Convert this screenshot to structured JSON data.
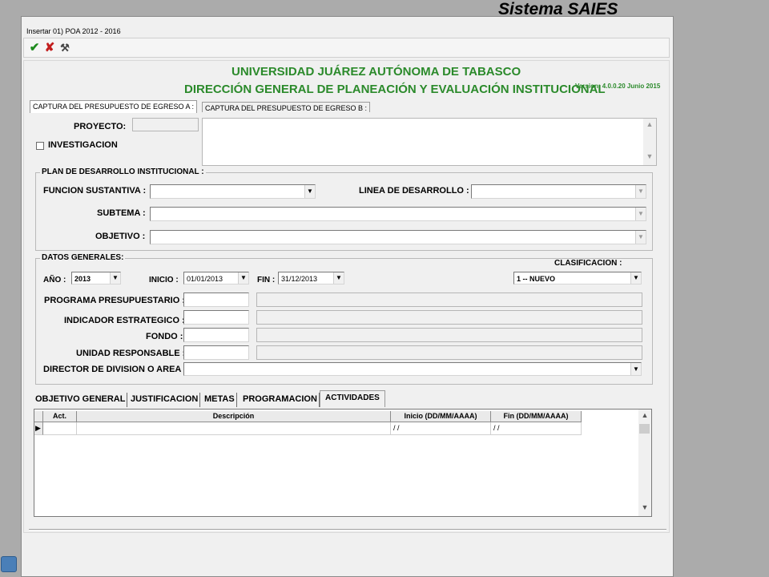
{
  "window": {
    "title": "Insertar 01) POA 2012 - 2016",
    "app_banner": "Sistema SAIES"
  },
  "toolbar": {
    "icons": [
      "check-icon",
      "cancel-x-icon",
      "tool-icon"
    ],
    "check_glyph": "✔",
    "cancel_glyph": "✘",
    "tool_glyph": "⚒"
  },
  "header": {
    "university": "UNIVERSIDAD JUÁREZ AUTÓNOMA DE TABASCO",
    "direction": "DIRECCIÓN GENERAL DE PLANEACIÓN Y EVALUACIÓN INSTITUCIONAL",
    "version": "Version:  4.0.0.20 Junio 2015"
  },
  "top_tabs": [
    {
      "label": "CAPTURA DEL PRESUPUESTO DE EGRESO  A :"
    },
    {
      "label": "CAPTURA DEL PRESUPUESTO DE EGRESO  B :"
    }
  ],
  "project": {
    "label": "PROYECTO:",
    "value": "",
    "investigacion_label": "INVESTIGACION",
    "investigacion_checked": false,
    "description": ""
  },
  "plan": {
    "title": "PLAN DE DESARROLLO INSTITUCIONAL :",
    "funcion_label": "FUNCION SUSTANTIVA :",
    "funcion_value": "",
    "linea_label": "LINEA DE DESARROLLO :",
    "linea_value": "",
    "subtema_label": "SUBTEMA :",
    "subtema_value": "",
    "objetivo_label": "OBJETIVO :",
    "objetivo_value": ""
  },
  "general": {
    "title": "DATOS GENERALES:",
    "anio_label": "AÑO :",
    "anio_value": "2013",
    "inicio_label": "INICIO :",
    "inicio_value": "01/01/2013",
    "fin_label": "FIN :",
    "fin_value": "31/12/2013",
    "clasificacion_label": "CLASIFICACION :",
    "clasificacion_value": "1 -- NUEVO",
    "programa_label": "PROGRAMA PRESUPUESTARIO :",
    "indicador_label": "INDICADOR ESTRATEGICO :",
    "fondo_label": "FONDO :",
    "unidad_label": "UNIDAD RESPONSABLE :",
    "director_label": "DIRECTOR DE DIVISION O AREA",
    "director_value": ""
  },
  "bottom_tabs": [
    {
      "label": "OBJETIVO GENERAL"
    },
    {
      "label": "JUSTIFICACION"
    },
    {
      "label": "METAS"
    },
    {
      "label": "PROGRAMACION"
    },
    {
      "label": "ACTIVIDADES"
    }
  ],
  "grid": {
    "columns": [
      "Act.",
      "Descripción",
      "Inicio (DD/MM/AAAA)",
      "Fin (DD/MM/AAAA)"
    ],
    "rows": [
      {
        "act": "",
        "descripcion": "",
        "inicio": "/ /",
        "fin": "/ /"
      }
    ],
    "row_pointer": "▶"
  },
  "colors": {
    "header_green": "#2b8a2b",
    "desktop": "#ababab",
    "window_bg": "#f0f0f0"
  }
}
